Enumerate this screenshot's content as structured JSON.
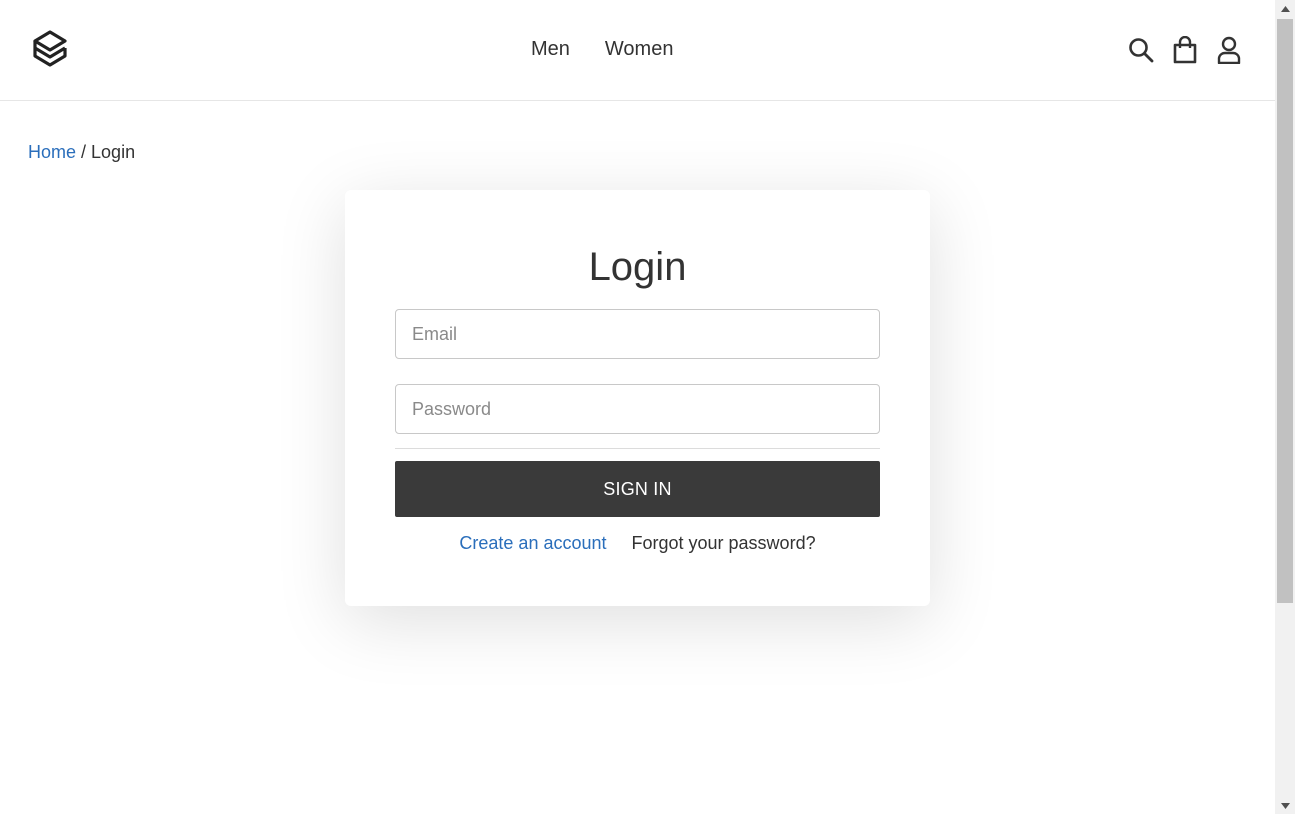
{
  "header": {
    "logo_icon": "stacked-layers-logo-icon",
    "nav": [
      {
        "label": "Men"
      },
      {
        "label": "Women"
      }
    ],
    "icons": [
      "search-icon",
      "shopping-bag-icon",
      "user-account-icon"
    ]
  },
  "breadcrumb": {
    "home": "Home",
    "separator": " / ",
    "current": "Login"
  },
  "login": {
    "title": "Login",
    "email_placeholder": "Email",
    "email_value": "",
    "password_placeholder": "Password",
    "password_value": "",
    "submit_label": "SIGN IN",
    "create_account": "Create an account",
    "forgot_password": "Forgot your password?"
  },
  "colors": {
    "link": "#2a6ebb",
    "button_bg": "#3a3a3a",
    "text": "#333333"
  }
}
